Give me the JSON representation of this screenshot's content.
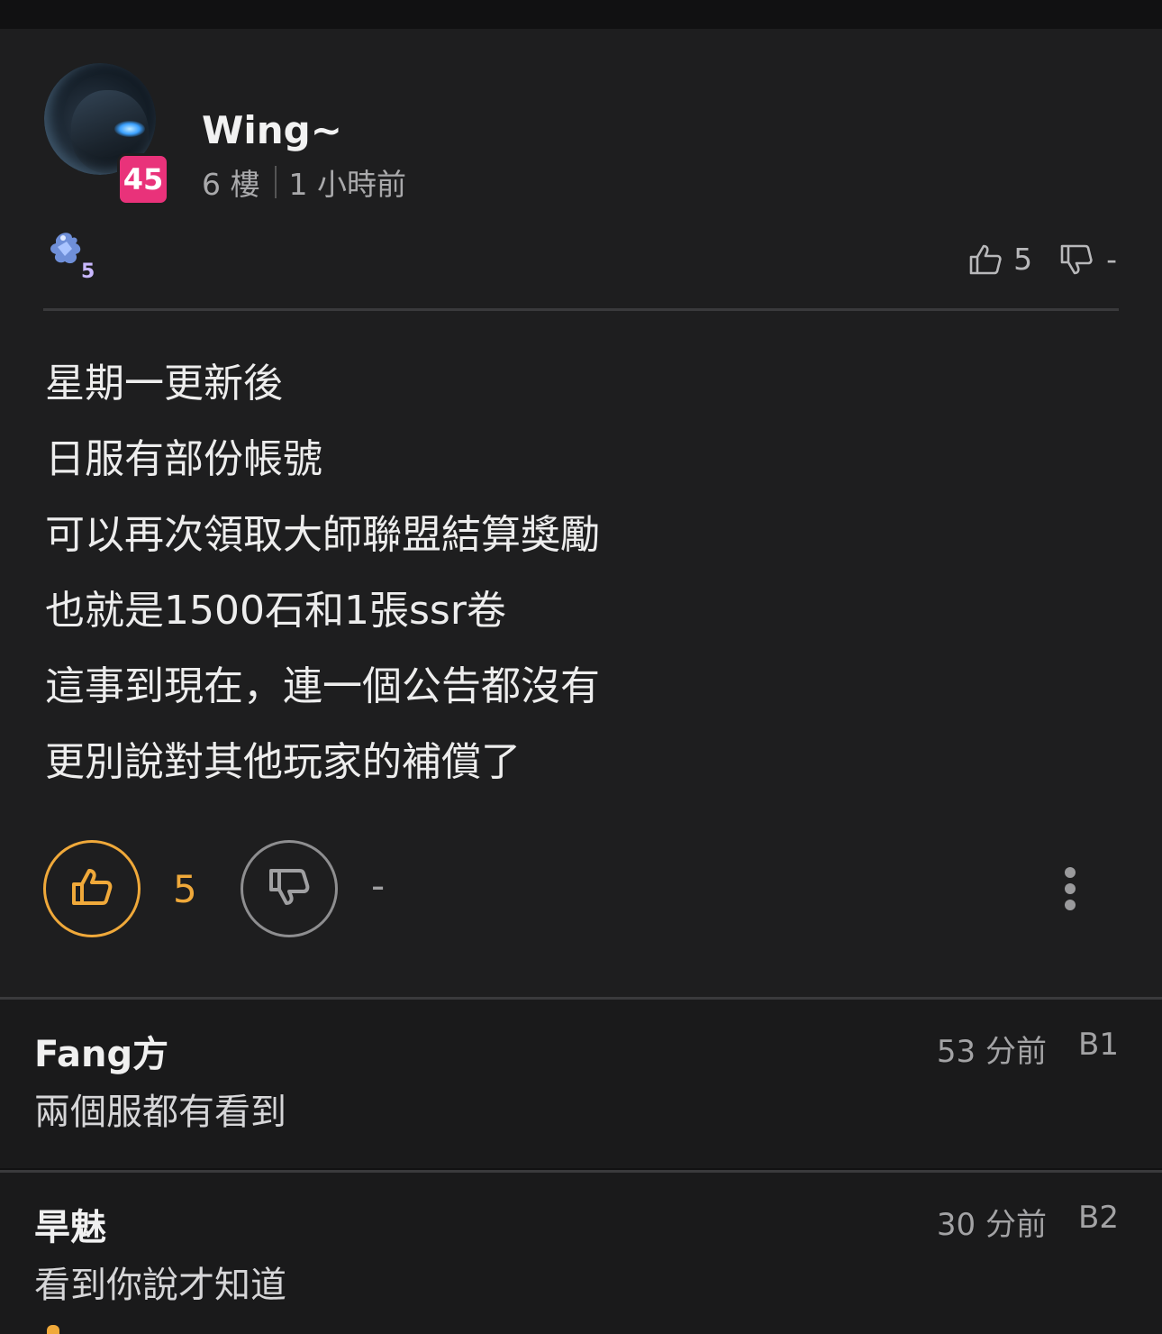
{
  "post": {
    "username": "Wing~",
    "level": "45",
    "floor": "6 樓",
    "time": "1 小時前",
    "guild_level": "5",
    "top_like_count": "5",
    "top_dislike_count": "-",
    "content": [
      "星期一更新後",
      "日服有部份帳號",
      "可以再次領取大師聯盟結算獎勵",
      "也就是1500石和1張ssr卷",
      "這事到現在，連一個公告都沒有",
      "更別說對其他玩家的補償了"
    ],
    "like_count": "5",
    "dislike_count": "-"
  },
  "replies": [
    {
      "name": "Fang方",
      "text": "兩個服都有看到",
      "time": "53 分前",
      "floor": "B1"
    },
    {
      "name": "旱魅",
      "text": "看到你說才知道",
      "time": "30 分前",
      "floor": "B2"
    }
  ],
  "colors": {
    "accent_orange": "#f0a93a",
    "badge_pink": "#e9327a",
    "background": "#1e1e1f"
  },
  "icons": [
    "thumbs-up-icon",
    "thumbs-down-icon",
    "more-vertical-icon",
    "guild-icon"
  ]
}
